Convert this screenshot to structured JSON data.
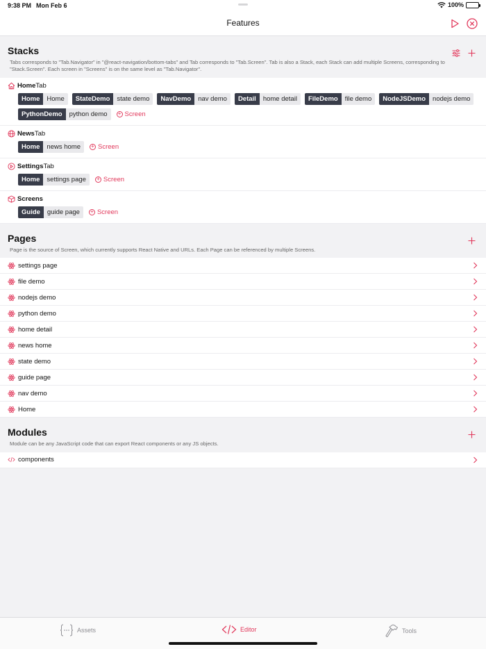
{
  "status": {
    "time": "9:38 PM",
    "date": "Mon Feb 6",
    "battery": "100%"
  },
  "nav": {
    "title": "Features",
    "play_icon": "play-icon",
    "close_icon": "close-circle-icon"
  },
  "colors": {
    "accent": "#e1375a",
    "chip_key": "#383c49",
    "chip_value": "#e9e9ec",
    "background": "#f2f2f4"
  },
  "stacks": {
    "title": "Stacks",
    "description": "Tabs corresponds to \"Tab.Navigator\" in \"@react-navigation/bottom-tabs\" and Tab corresponds to \"Tab.Screen\". Tab is also a Stack, each Stack can add multiple Screens, corresponding to \"Stack.Screen\". Each screen in \"Screens\" is on the same level as \"Tab.Navigator\".",
    "add_screen_label": "Screen",
    "items": [
      {
        "name": "Home",
        "suffix": "Tab",
        "icon": "home-icon",
        "chips": [
          {
            "key": "Home",
            "value": "Home"
          },
          {
            "key": "StateDemo",
            "value": "state demo"
          },
          {
            "key": "NavDemo",
            "value": "nav demo"
          },
          {
            "key": "Detail",
            "value": "home detail"
          },
          {
            "key": "FileDemo",
            "value": "file demo"
          },
          {
            "key": "NodeJSDemo",
            "value": "nodejs demo"
          },
          {
            "key": "PythonDemo",
            "value": "python demo"
          }
        ]
      },
      {
        "name": "News",
        "suffix": "Tab",
        "icon": "globe-icon",
        "chips": [
          {
            "key": "Home",
            "value": "news home"
          }
        ]
      },
      {
        "name": "Settings",
        "suffix": "Tab",
        "icon": "settings-icon",
        "chips": [
          {
            "key": "Home",
            "value": "settings page"
          }
        ]
      },
      {
        "name": "Screens",
        "suffix": "",
        "icon": "cube-icon",
        "chips": [
          {
            "key": "Guide",
            "value": "guide page"
          }
        ]
      }
    ]
  },
  "pages": {
    "title": "Pages",
    "description": "Page is the source of Screen, which currently supports React Native and URLs. Each Page can be referenced by multiple Screens.",
    "items": [
      "settings page",
      "file demo",
      "nodejs demo",
      "python demo",
      "home detail",
      "news home",
      "state demo",
      "guide page",
      "nav demo",
      "Home"
    ]
  },
  "modules": {
    "title": "Modules",
    "description": "Module can be any JavaScript code that can export React components or any JS objects.",
    "items": [
      "components"
    ]
  },
  "tabbar": {
    "tabs": [
      {
        "label": "Assets",
        "icon": "braces-icon",
        "active": false
      },
      {
        "label": "Editor",
        "icon": "code-icon",
        "active": true
      },
      {
        "label": "Tools",
        "icon": "hammer-icon",
        "active": false
      }
    ]
  }
}
